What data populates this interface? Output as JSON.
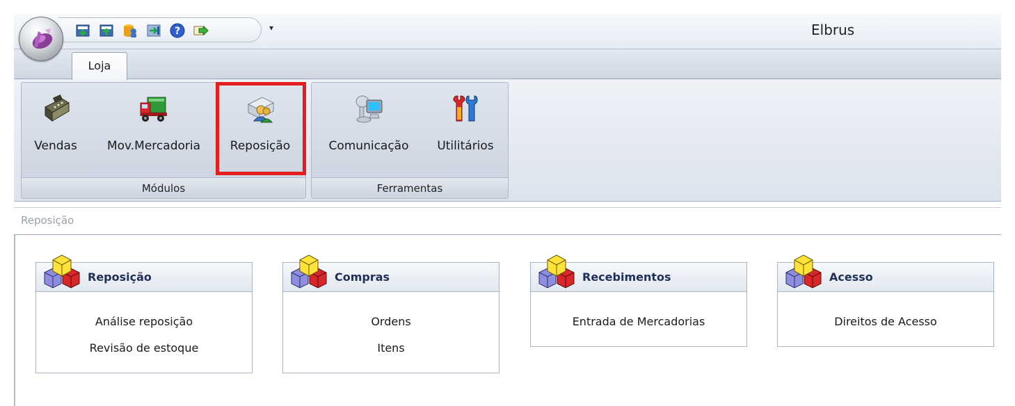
{
  "window": {
    "title": "Elbrus",
    "qat_dropdown_glyph": "▾",
    "qat_icons": [
      "download-icon",
      "upload-icon",
      "database-user-icon",
      "export-icon",
      "help-icon",
      "forward-icon"
    ]
  },
  "tabs": [
    {
      "label": "Loja",
      "active": true
    }
  ],
  "ribbon": {
    "groups": [
      {
        "label": "Módulos",
        "buttons": [
          {
            "label": "Vendas",
            "icon": "cash-register-icon"
          },
          {
            "label": "Mov.Mercadoria",
            "icon": "truck-icon"
          },
          {
            "label": "Reposição",
            "icon": "restock-user-icon",
            "highlighted": true
          }
        ]
      },
      {
        "label": "Ferramentas",
        "buttons": [
          {
            "label": "Comunicação",
            "icon": "network-computer-icon"
          },
          {
            "label": "Utilitários",
            "icon": "tools-icon"
          }
        ]
      }
    ],
    "highlight_color": "#e41d1d"
  },
  "content": {
    "title": "Reposição",
    "panels": [
      {
        "title": "Reposição",
        "icon": "cubes-icon",
        "links": [
          "Análise reposição",
          "Revisão de estoque"
        ]
      },
      {
        "title": "Compras",
        "icon": "cubes-icon",
        "links": [
          "Ordens",
          "Itens"
        ]
      },
      {
        "title": "Recebimentos",
        "icon": "cubes-icon",
        "links": [
          "Entrada de Mercadorias"
        ]
      },
      {
        "title": "Acesso",
        "icon": "cubes-icon",
        "links": [
          "Direitos de Acesso"
        ]
      }
    ]
  },
  "colors": {
    "panel_title": "#1f2f55",
    "ribbon_bg": "#dde3ec"
  }
}
